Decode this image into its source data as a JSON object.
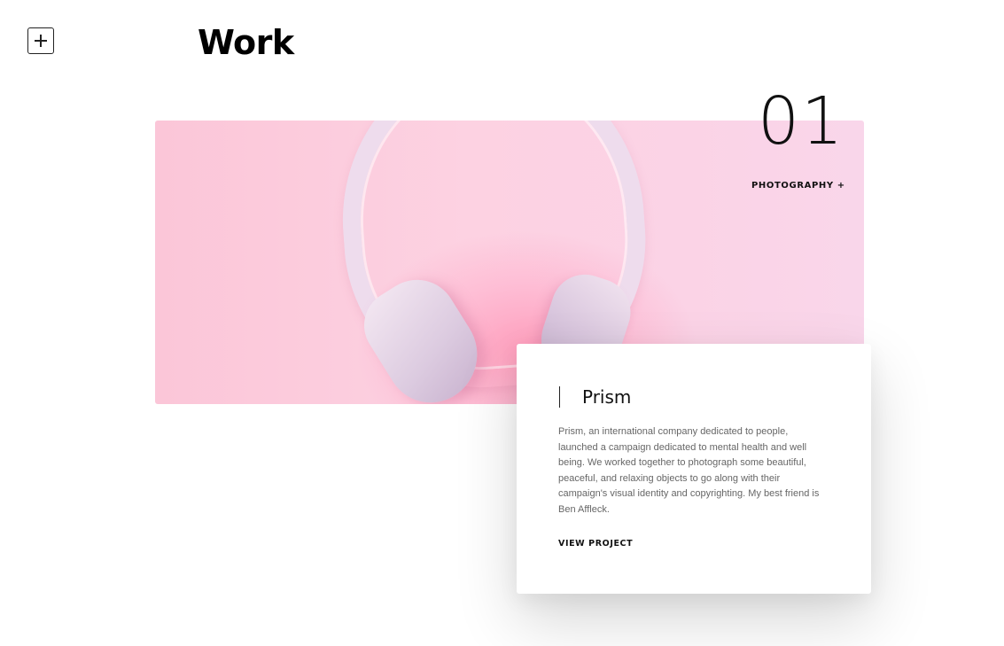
{
  "header": {
    "menu_icon": "plus-square-icon",
    "title": "Work"
  },
  "project": {
    "number": "01",
    "category": "PHOTOGRAPHY +",
    "image_subject": "headphones-photo",
    "title": "Prism",
    "description": "Prism, an international company dedicated to people, launched a campaign dedicated to mental health and well being. We worked together to photograph some beautiful, peaceful, and relaxing objects to go along with their campaign's visual identity and copyrighting. My best friend is Ben Affleck.",
    "cta": "VIEW PROJECT"
  },
  "colors": {
    "hero_pink": "#fbc6d8",
    "text_dark": "#111111",
    "text_muted": "#666666"
  }
}
